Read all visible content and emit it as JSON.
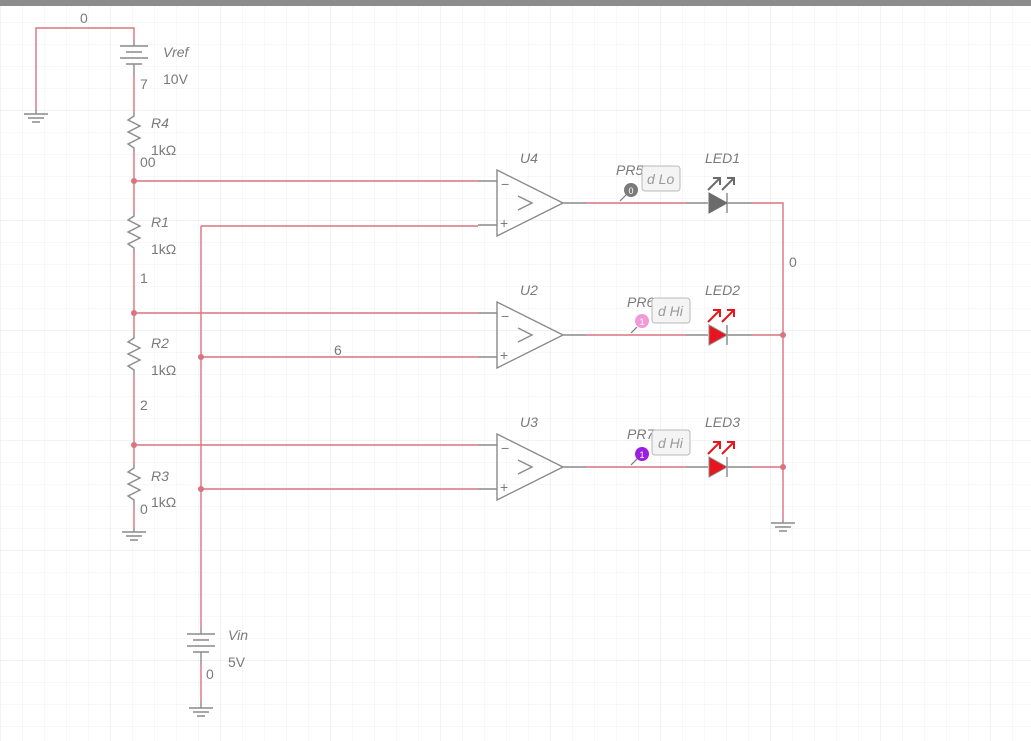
{
  "colors": {
    "wire": "#d9737f",
    "component": "#8a8a8a",
    "led_on": "#e8141e",
    "led_off": "#6b6b6b",
    "grid": "#eeeeee"
  },
  "components": {
    "vref": {
      "name": "Vref",
      "value": "10V"
    },
    "vin": {
      "name": "Vin",
      "value": "5V"
    },
    "r4": {
      "name": "R4",
      "value": "1kΩ"
    },
    "r1": {
      "name": "R1",
      "value": "1kΩ"
    },
    "r2": {
      "name": "R2",
      "value": "1kΩ"
    },
    "r3": {
      "name": "R3",
      "value": "1kΩ"
    },
    "u4": {
      "name": "U4"
    },
    "u2": {
      "name": "U2"
    },
    "u3": {
      "name": "U3"
    },
    "led1": {
      "name": "LED1",
      "state": "off"
    },
    "led2": {
      "name": "LED2",
      "state": "on"
    },
    "led3": {
      "name": "LED3",
      "state": "on"
    }
  },
  "probes": {
    "pr5": {
      "name": "PR5",
      "reading": "d Lo",
      "badge": "0",
      "color": "#7a7a7a"
    },
    "pr6": {
      "name": "PR6",
      "reading": "d Hi",
      "badge": "1",
      "color": "#f29ad6"
    },
    "pr7": {
      "name": "PR7",
      "reading": "d Hi",
      "badge": "1",
      "color": "#9b1fe0"
    }
  },
  "nets": {
    "top_gnd": "0",
    "vref_minus": "7",
    "r4_r1": "00",
    "r1_r2": "1",
    "r2_r3": "2",
    "r3_bottom": "0",
    "vin_line": "6",
    "led_return": "0",
    "vin_bottom": "0"
  },
  "opamp_pins": {
    "minus": "−",
    "plus": "+",
    "symbol": ">"
  }
}
